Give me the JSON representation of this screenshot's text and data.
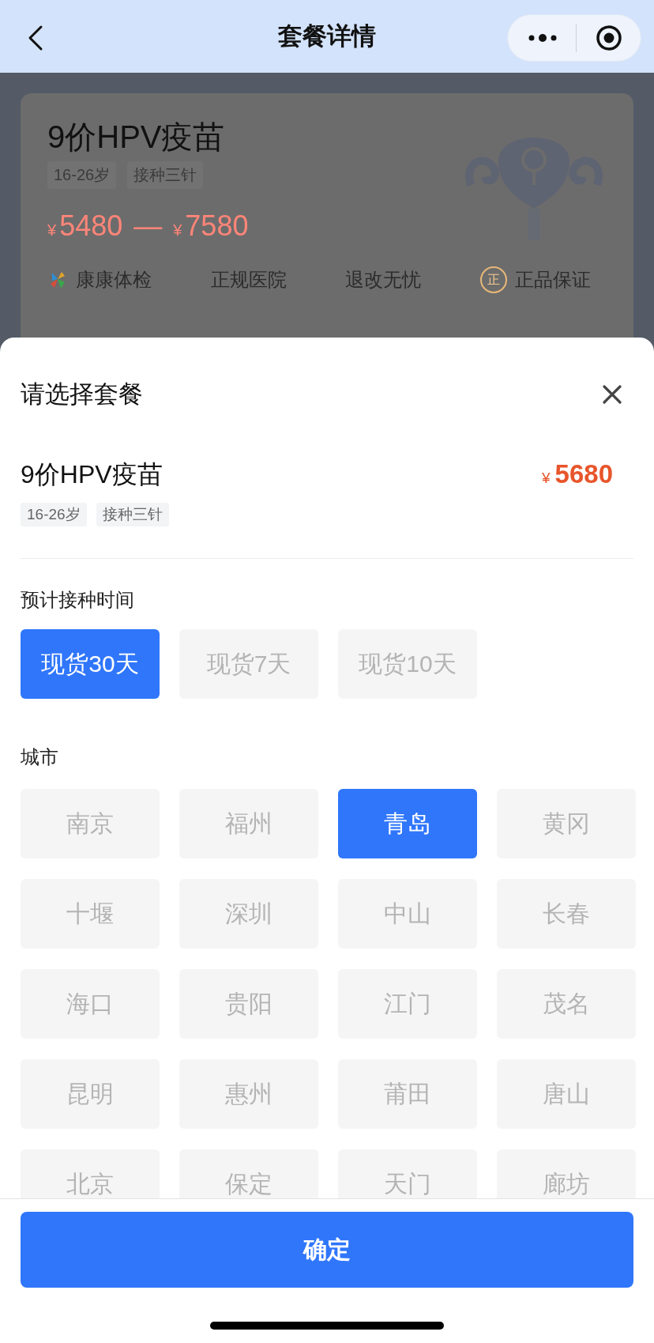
{
  "nav": {
    "title": "套餐详情"
  },
  "card": {
    "name": "9价HPV疫苗",
    "tags": [
      "16-26岁",
      "接种三针"
    ],
    "price": {
      "low_currency": "¥",
      "low": "5480",
      "dash": "—",
      "high_currency": "¥",
      "high": "7580"
    },
    "features": [
      {
        "label": "康康体检",
        "kind": "brand"
      },
      {
        "label": "正规医院",
        "kind": "plain"
      },
      {
        "label": "退改无忧",
        "kind": "plain"
      },
      {
        "label": "正品保证",
        "kind": "seal",
        "seal_text": "正"
      }
    ]
  },
  "sheet": {
    "title": "请选择套餐",
    "package": {
      "name": "9价HPV疫苗",
      "currency": "¥",
      "price": "5680",
      "tags": [
        "16-26岁",
        "接种三针"
      ]
    },
    "sections": [
      {
        "label": "预计接种时间",
        "options": [
          {
            "label": "现货30天",
            "selected": true
          },
          {
            "label": "现货7天",
            "selected": false
          },
          {
            "label": "现货10天",
            "selected": false
          }
        ]
      },
      {
        "label": "城市",
        "options": [
          {
            "label": "南京",
            "selected": false
          },
          {
            "label": "福州",
            "selected": false
          },
          {
            "label": "青岛",
            "selected": true
          },
          {
            "label": "黄冈",
            "selected": false
          },
          {
            "label": "十堰",
            "selected": false
          },
          {
            "label": "深圳",
            "selected": false
          },
          {
            "label": "中山",
            "selected": false
          },
          {
            "label": "长春",
            "selected": false
          },
          {
            "label": "海口",
            "selected": false
          },
          {
            "label": "贵阳",
            "selected": false
          },
          {
            "label": "江门",
            "selected": false
          },
          {
            "label": "茂名",
            "selected": false
          },
          {
            "label": "昆明",
            "selected": false
          },
          {
            "label": "惠州",
            "selected": false
          },
          {
            "label": "莆田",
            "selected": false
          },
          {
            "label": "唐山",
            "selected": false
          },
          {
            "label": "北京",
            "selected": false
          },
          {
            "label": "保定",
            "selected": false
          },
          {
            "label": "天门",
            "selected": false
          },
          {
            "label": "廊坊",
            "selected": false
          }
        ]
      }
    ],
    "confirm": "确定"
  }
}
